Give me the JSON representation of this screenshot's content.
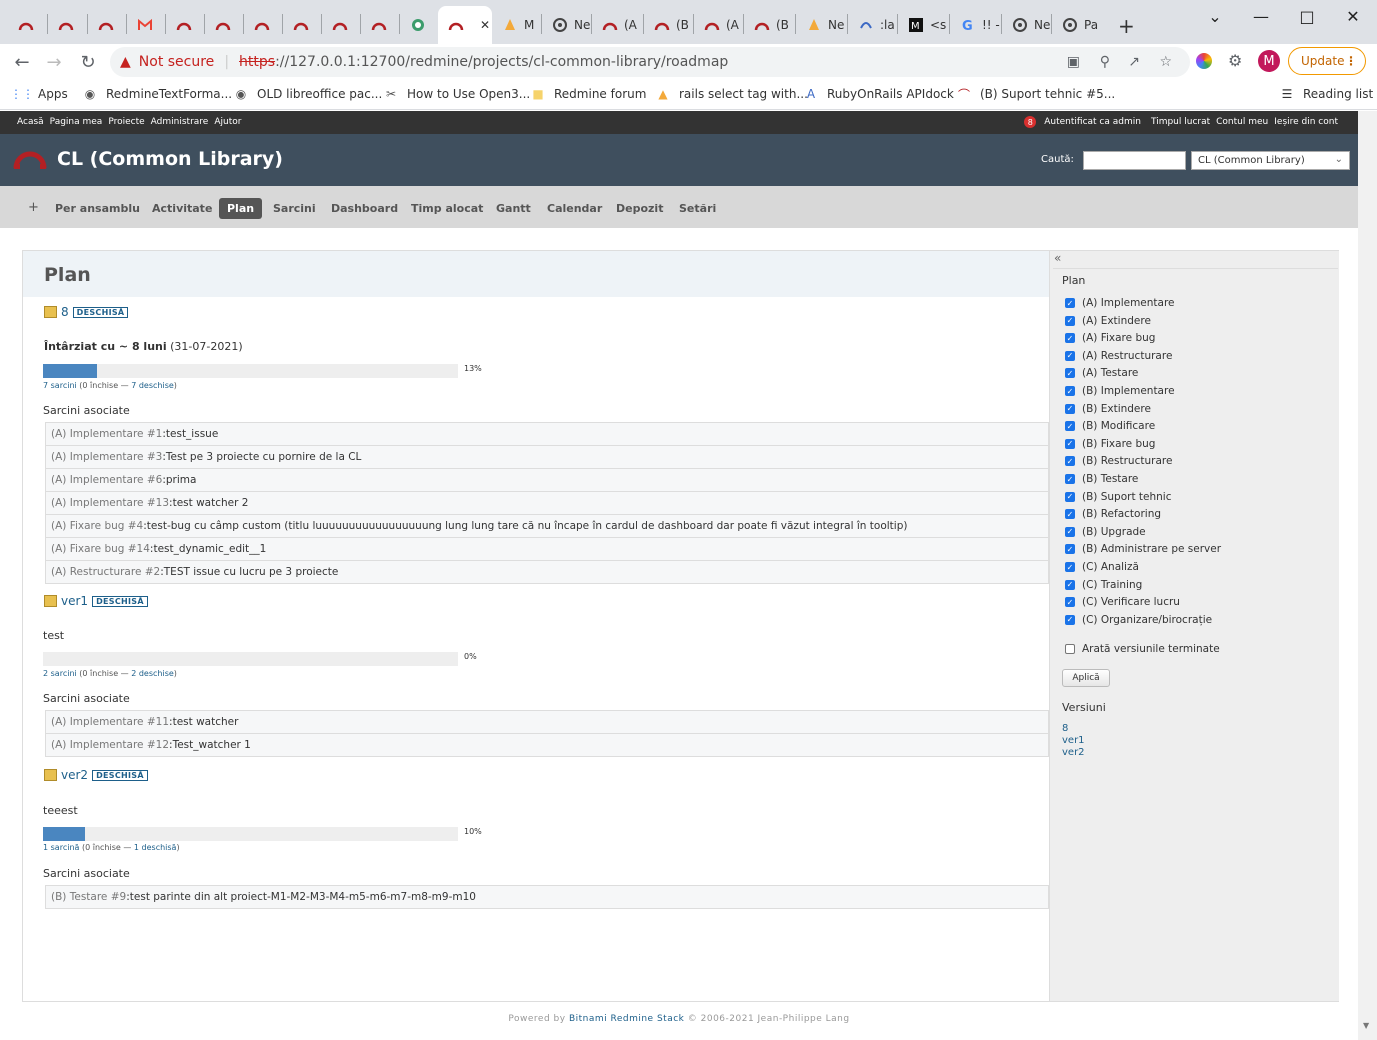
{
  "browser": {
    "tabs": [
      {
        "label": ""
      },
      {
        "label": ""
      },
      {
        "label": ""
      },
      {
        "label": ""
      },
      {
        "label": ""
      },
      {
        "label": ""
      },
      {
        "label": ""
      },
      {
        "label": ""
      },
      {
        "label": ""
      },
      {
        "label": ""
      },
      {
        "label": ""
      },
      {
        "label": ""
      },
      {
        "label": "M"
      },
      {
        "label": "Ne"
      },
      {
        "label": "(A"
      },
      {
        "label": "(B"
      },
      {
        "label": "(A"
      },
      {
        "label": "(B"
      },
      {
        "label": "Ne"
      },
      {
        "label": ":la"
      },
      {
        "label": "<s"
      },
      {
        "label": "!! -"
      },
      {
        "label": "Ne"
      },
      {
        "label": "Pa"
      }
    ],
    "not_secure": "Not secure",
    "url_scheme": "https",
    "url_rest": "://127.0.0.1:12700/redmine/projects/cl-common-library/roadmap",
    "update_label": "Update",
    "profile_initial": "M",
    "bookmarks": [
      {
        "label": "Apps"
      },
      {
        "label": "RedmineTextForma..."
      },
      {
        "label": "OLD libreoffice pac..."
      },
      {
        "label": "How to Use Open3..."
      },
      {
        "label": "Redmine forum"
      },
      {
        "label": "rails select tag with..."
      },
      {
        "label": "RubyOnRails APIdock"
      },
      {
        "label": "(B) Suport tehnic #5..."
      }
    ],
    "reading_list": "Reading list"
  },
  "topmenu": {
    "left": [
      "Acasă",
      "Pagina mea",
      "Proiecte",
      "Administrare",
      "Ajutor"
    ],
    "notif_count": "8",
    "logged_in": "Autentificat ca admin",
    "right": [
      "Timpul lucrat",
      "Contul meu",
      "Ieșire din cont"
    ]
  },
  "header": {
    "project_title": "CL (Common Library)",
    "search_label": "Caută:",
    "search_value": "",
    "project_select": "CL (Common Library)"
  },
  "mainmenu": {
    "plus": "+",
    "items": [
      "Per ansamblu",
      "Activitate",
      "Plan",
      "Sarcini",
      "Dashboard",
      "Timp alocat",
      "Gantt",
      "Calendar",
      "Depozit",
      "Setări"
    ],
    "selected": "Plan"
  },
  "page": {
    "title": "Plan",
    "assoc_label": "Sarcini asociate",
    "versions": [
      {
        "name": "8",
        "status": "DESCHISĂ",
        "late_prefix": "Întârziat cu ~ 8 luni",
        "late_date": "(31-07-2021)",
        "progress": 13,
        "pct_label": "13%",
        "count_link": "7 sarcini",
        "closed": "(0 închise —",
        "open_link": "7 deschise",
        "close_paren": ")",
        "issues": [
          {
            "tracker": "(A) Implementare #1",
            "subject": "test_issue"
          },
          {
            "tracker": "(A) Implementare #3",
            "subject": "Test pe 3 proiecte cu pornire de la CL"
          },
          {
            "tracker": "(A) Implementare #6",
            "subject": "prima"
          },
          {
            "tracker": "(A) Implementare #13",
            "subject": "test watcher 2"
          },
          {
            "tracker": "(A) Fixare bug #4",
            "subject": "test-bug cu câmp custom (titlu luuuuuuuuuuuuuuuuung lung lung tare că nu încape în cardul de dashboard dar poate fi văzut integral în tooltip)"
          },
          {
            "tracker": "(A) Fixare bug #14",
            "subject": "test_dynamic_edit__1"
          },
          {
            "tracker": "(A) Restructurare #2",
            "subject": "TEST issue cu lucru pe 3 proiecte"
          }
        ]
      },
      {
        "name": "ver1",
        "status": "DESCHISĂ",
        "description": "test",
        "progress": 0,
        "pct_label": "0%",
        "count_link": "2 sarcini",
        "closed": "(0 închise —",
        "open_link": "2 deschise",
        "close_paren": ")",
        "issues": [
          {
            "tracker": "(A) Implementare #11",
            "subject": "test watcher"
          },
          {
            "tracker": "(A) Implementare #12",
            "subject": "Test_watcher 1"
          }
        ]
      },
      {
        "name": "ver2",
        "status": "DESCHISĂ",
        "description": "teeest",
        "progress": 10,
        "pct_label": "10%",
        "count_link": "1 sarcină",
        "closed": "(0 închise —",
        "open_link": "1 deschisă",
        "close_paren": ")",
        "issues": [
          {
            "tracker": "(B) Testare #9",
            "subject": "test parinte din alt proiect-M1-M2-M3-M4-m5-m6-m7-m8-m9-m10"
          }
        ]
      }
    ]
  },
  "sidebar": {
    "collapse": "«",
    "plan_title": "Plan",
    "trackers": [
      "(A) Implementare",
      "(A) Extindere",
      "(A) Fixare bug",
      "(A) Restructurare",
      "(A) Testare",
      "(B) Implementare",
      "(B) Extindere",
      "(B) Modificare",
      "(B) Fixare bug",
      "(B) Restructurare",
      "(B) Testare",
      "(B) Suport tehnic",
      "(B) Refactoring",
      "(B) Upgrade",
      "(B) Administrare pe server",
      "(C) Analiză",
      "(C) Training",
      "(C) Verificare lucru",
      "(C) Organizare/birocrație"
    ],
    "show_completed": "Arată versiunile terminate",
    "apply": "Aplică",
    "versions_title": "Versiuni",
    "versions": [
      "8",
      "ver1",
      "ver2"
    ]
  },
  "footer": {
    "powered": "Powered by",
    "link": "Bitnami Redmine Stack",
    "copy": "© 2006-2021 Jean-Philippe Lang"
  },
  "colors": {
    "progress_fill": "#4a86c0",
    "link": "#1d5f8a",
    "header_bg": "#3f4f5e"
  }
}
